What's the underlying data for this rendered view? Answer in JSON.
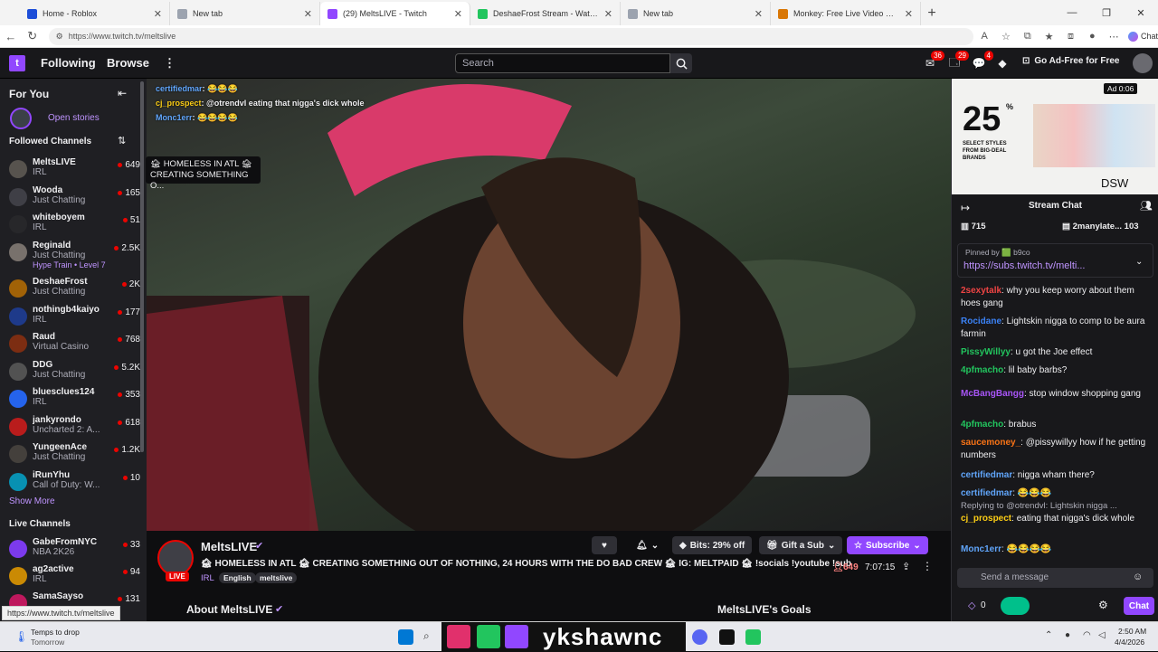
{
  "browser": {
    "tabs": [
      {
        "title": "Home - Roblox",
        "color": "#1d4ed8"
      },
      {
        "title": "New tab",
        "color": "#9ca3af"
      },
      {
        "title": "(29) MeltsLIVE - Twitch",
        "color": "#9147ff"
      },
      {
        "title": "DeshaeFrost Stream - Watch Live",
        "color": "#22c55e"
      },
      {
        "title": "New tab",
        "color": "#9ca3af"
      },
      {
        "title": "Monkey: Free Live Video Chat",
        "color": "#d97706"
      }
    ],
    "url": "https://www.twitch.tv/meltslive",
    "chat_label": "Chat"
  },
  "twitch": {
    "nav": {
      "following": "Following",
      "browse": "Browse",
      "search_placeholder": "Search",
      "go_ad_free": "Go Ad-Free for Free",
      "badges": {
        "inbox": "36",
        "notifications": "29",
        "whispers": "4"
      }
    },
    "sidebar": {
      "for_you": "For You",
      "open_stories": "Open stories",
      "followed_header": "Followed Channels",
      "followed": [
        {
          "name": "MeltsLIVE",
          "category": "IRL",
          "viewers": "649",
          "color": "#57534e"
        },
        {
          "name": "Wooda",
          "category": "Just Chatting",
          "viewers": "165",
          "color": "#3f3f46"
        },
        {
          "name": "whiteboyem",
          "category": "IRL",
          "viewers": "51",
          "color": "#27272a"
        },
        {
          "name": "Reginald",
          "category": "Just Chatting",
          "viewers": "2.5K",
          "extra": "Hype Train • Level 7",
          "color": "#78716c"
        },
        {
          "name": "DeshaeFrost",
          "category": "Just Chatting",
          "viewers": "2K",
          "color": "#a16207"
        },
        {
          "name": "nothingb4kaiyo",
          "category": "IRL",
          "viewers": "177",
          "color": "#1e3a8a"
        },
        {
          "name": "Raud",
          "category": "Virtual Casino",
          "viewers": "768",
          "color": "#7c2d12"
        },
        {
          "name": "DDG",
          "category": "Just Chatting",
          "viewers": "5.2K",
          "color": "#525252"
        },
        {
          "name": "bluesclues124",
          "category": "IRL",
          "viewers": "353",
          "color": "#2563eb"
        },
        {
          "name": "jankyrondo",
          "category": "Uncharted 2: A...",
          "viewers": "618",
          "color": "#b91c1c"
        },
        {
          "name": "YungeenAce",
          "category": "Just Chatting",
          "viewers": "1.2K",
          "color": "#44403c"
        },
        {
          "name": "iRunYhu",
          "category": "Call of Duty: W...",
          "viewers": "10",
          "color": "#0891b2"
        }
      ],
      "show_more": "Show More",
      "live_header": "Live Channels",
      "live": [
        {
          "name": "GabeFromNYC",
          "category": "NBA 2K26",
          "viewers": "33",
          "color": "#7c3aed"
        },
        {
          "name": "ag2active",
          "category": "IRL",
          "viewers": "94",
          "color": "#ca8a04"
        },
        {
          "name": "SamaSayso",
          "category": "",
          "viewers": "131",
          "color": "#be185d"
        }
      ],
      "tooltip": "🏚 HOMELESS IN ATL 🏚 CREATING SOMETHING O..."
    },
    "video_overlay": [
      {
        "user": "certifiedmar",
        "text": "😂😂😂",
        "color": "#60a5fa"
      },
      {
        "user": "cj_prospect",
        "text": "@otrendvl eating that nigga's dick whole",
        "color": "#facc15"
      },
      {
        "user": "Monc1err",
        "text": "😂😂😂😂",
        "color": "#60a5fa"
      }
    ],
    "stream": {
      "channel": "MeltsLIVE",
      "live_label": "LIVE",
      "title": "🏚 HOMELESS IN ATL 🏚 CREATING SOMETHING OUT OF NOTHING, 24 HOURS WITH THE DO BAD CREW 🏚 IG: MELTPAID 🏚 !socials !youtube !sub",
      "category": "IRL",
      "tags": [
        "English",
        "meltslive"
      ],
      "viewers": "649",
      "uptime": "7:07:15",
      "bits": "Bits: 29% off",
      "gift": "Gift a Sub",
      "subscribe": "Subscribe",
      "about": "About MeltsLIVE",
      "goals": "MeltsLIVE's Goals"
    },
    "ad": {
      "timer": "Ad 0:06",
      "percent": "25",
      "tagline": "SELECT STYLES FROM BIG-DEAL BRANDS",
      "brand": "DSW"
    },
    "chat": {
      "title": "Stream Chat",
      "leader_left": "715",
      "leader_right_name": "2manylate...",
      "leader_right_val": "103",
      "pinned_by": "Pinned by 🟩 b9co",
      "pinned_link": "https://subs.twitch.tv/melti...",
      "messages": [
        {
          "user": "2sexytalk",
          "text": ": why you keep worry about them hoes gang",
          "color": "#ef4444"
        },
        {
          "user": "Rocidane",
          "text": ": Lightskin nigga to comp to be aura farmin",
          "color": "#3b82f6"
        },
        {
          "user": "PissyWillyy",
          "text": ": u got the Joe effect",
          "color": "#22c55e"
        },
        {
          "user": "4pfmacho",
          "text": ": lil baby barbs?",
          "color": "#22c55e"
        },
        {
          "user": "McBangBangg",
          "text": ": stop window shopping gang",
          "color": "#a855f7"
        },
        {
          "user": "4pfmacho",
          "text": ": brabus",
          "color": "#22c55e"
        },
        {
          "user": "saucemoney_",
          "text": ": @pissywillyy how if he getting numbers",
          "color": "#f97316"
        },
        {
          "user": "certifiedmar",
          "text": ": nigga wham there?",
          "color": "#60a5fa"
        },
        {
          "user": "certifiedmar",
          "text": ": 😂😂😂",
          "color": "#60a5fa"
        },
        {
          "user": "",
          "text": "Replying to @otrendvl: Lightskin nigga ...",
          "color": "#adadb8"
        },
        {
          "user": "cj_prospect",
          "text": ": eating that nigga's dick whole",
          "color": "#facc15"
        },
        {
          "user": "Monc1err",
          "text": ": 😂😂😂😂",
          "color": "#60a5fa"
        }
      ],
      "input_placeholder": "Send a message",
      "points": "0",
      "send": "Chat"
    }
  },
  "status_url": "https://www.twitch.tv/meltslive",
  "taskbar": {
    "weather_title": "Temps to drop",
    "weather_sub": "Tomorrow",
    "time": "2:50 AM",
    "date": "4/4/2026",
    "overlay_text": "ykshawnc"
  }
}
